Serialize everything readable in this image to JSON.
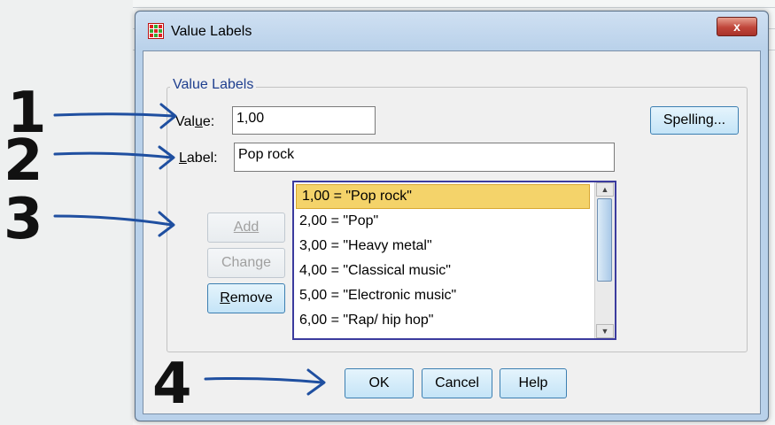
{
  "dialog": {
    "title": "Value Labels",
    "close_label": "x",
    "group_label": "Value Labels",
    "value_label": "Value:",
    "value_label_pre": "Val",
    "value_label_u": "u",
    "value_label_post": "e:",
    "value_input": "1,00",
    "label_label_u": "L",
    "label_label_post": "abel:",
    "label_input": "Pop rock",
    "spelling_button": "Spelling...",
    "add_button": "Add",
    "change_button": "Change",
    "remove_button_u": "R",
    "remove_button_post": "emove",
    "list_items": [
      "1,00 = \"Pop rock\"",
      "2,00 = \"Pop\"",
      "3,00 = \"Heavy metal\"",
      "4,00 = \"Classical music\"",
      "5,00 = \"Electronic music\"",
      "6,00 = \"Rap/ hip hop\""
    ],
    "ok_button": "OK",
    "cancel_button": "Cancel",
    "help_button": "Help"
  },
  "annotations": {
    "one": "1",
    "two": "2",
    "three": "3",
    "four": "4"
  },
  "colors": {
    "arrow": "#1f4fa0",
    "accent_blue": "#3c7fb1",
    "selection": "#f4d36a"
  }
}
